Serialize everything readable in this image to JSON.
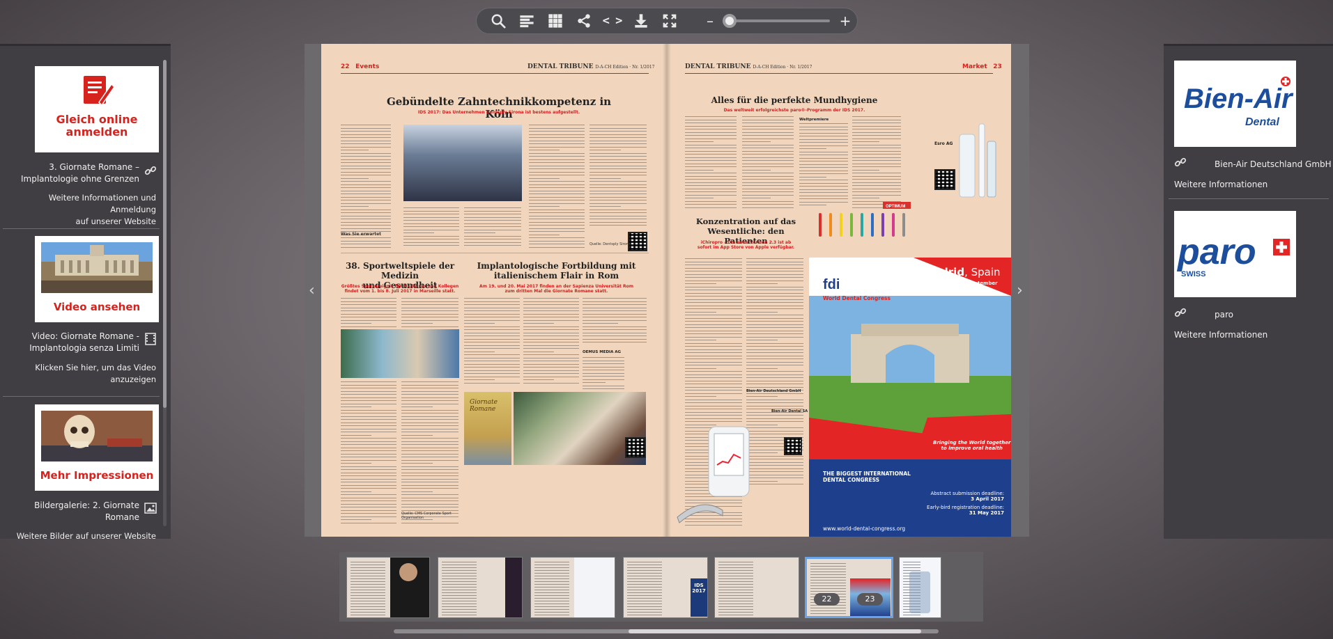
{
  "toolbar": {
    "icons": [
      "search-icon",
      "toc-icon",
      "grid-icon",
      "share-icon",
      "embed-icon",
      "download-icon",
      "fullscreen-icon"
    ],
    "embed_label": "< >",
    "zoom_minus": "–",
    "zoom_plus": "+",
    "zoom_level": 0
  },
  "left_panel": {
    "items": [
      {
        "button_text_1": "Gleich online",
        "button_text_2": "anmelden",
        "title": "3. Giornate Romane –\nImplantologie ohne Grenzen",
        "link": "Weitere Informationen und Anmeldung\nauf unserer Website",
        "icon": "link-icon"
      },
      {
        "button_text": "Video ansehen",
        "title": "Video: Giornate Romane -\nImplantologia senza Limiti",
        "link": "Klicken Sie hier, um das Video\nanzuzeigen",
        "icon": "video-icon"
      },
      {
        "button_text": "Mehr Impressionen",
        "title": "Bildergalerie: 2. Giornate\nRomane",
        "link": "Weitere Bilder auf unserer Website",
        "icon": "image-icon"
      }
    ]
  },
  "right_panel": {
    "items": [
      {
        "logo_text": "Bien-Air",
        "logo_sub": "Dental",
        "title": "Bien-Air Deutschland GmbH",
        "link": "Weitere Informationen",
        "icon": "link-icon"
      },
      {
        "logo_text": "paro",
        "logo_sub": "SWISS",
        "title": "paro",
        "link": "Weitere Informationen",
        "icon": "link-icon"
      }
    ]
  },
  "left_page": {
    "page_number": "22",
    "section": "Events",
    "masthead": "DENTAL TRIBUNE",
    "edition": "D-A-CH Edition · Nr. 1/2017",
    "headline": "Gebündelte Zahntechnikkompetenz in Köln",
    "subhead": "IDS 2017: Das Unternehmen Dentsply Sirona ist bestens aufgestellt.",
    "sub_heading": "Was Sie erwartet",
    "article2_title": "38. Sportweltspiele der Medizin\nund Gesundheit",
    "article2_sub": "Größtes Sportereignis für Mediziner und Kollegen\nfindet vom 1. bis 8. Juli 2017 in Marseille statt.",
    "article3_title": "Implantologische Fortbildung mit\nitalienischem Flair in Rom",
    "article3_sub": "Am 19. und 20. Mai 2017 finden an der Sapienza Universität Rom\nzum dritten Mal die Giornate Romane statt.",
    "contact_name": "OEMUS MEDIA AG",
    "source": "Quelle: Dentsply Sirona",
    "source2": "Quelle: CMS Corporate Sport\nOrganisation",
    "book_title": "Giornate\nRomane"
  },
  "right_page": {
    "page_number": "23",
    "section": "Market",
    "masthead": "DENTAL TRIBUNE",
    "edition": "D-A-CH Edition · Nr. 1/2017",
    "headline": "Alles für die perfekte Mundhygiene",
    "subhead": "Das weltweit erfolgreichste paro®-Programm der IDS 2017.",
    "ad_label": "Weltpremiere",
    "article2_title": "Konzentration auf das\nWesentliche: den Patienten",
    "article2_sub": "iChiropro – Die neue Version 2.3 ist ab\nsofort im App Store von Apple verfügbar.",
    "contact_name": "Bien-Air Deutschland GmbH",
    "contact_name2": "Bien-Air Dental SA",
    "contact": "Esro AG",
    "tag": "OPTIMUM",
    "ad": {
      "org": "fdi",
      "org_sub": "World Dental Congress",
      "city": "Madrid",
      "country": ", Spain",
      "dates": "29 August - 1 September 2017",
      "slogan": "Bringing the World together\nto improve oral health",
      "banner": "THE BIGGEST INTERNATIONAL\nDENTAL CONGRESS",
      "deadline1_label": "Abstract submission deadline:",
      "deadline1": "3 April 2017",
      "deadline2_label": "Early-bird registration deadline:",
      "deadline2": "31 May 2017",
      "url": "www.world-dental-congress.org"
    }
  },
  "thumbnails": {
    "count": 7,
    "active_left": "22",
    "active_right": "23",
    "ids_text": "IDS\n2017"
  }
}
